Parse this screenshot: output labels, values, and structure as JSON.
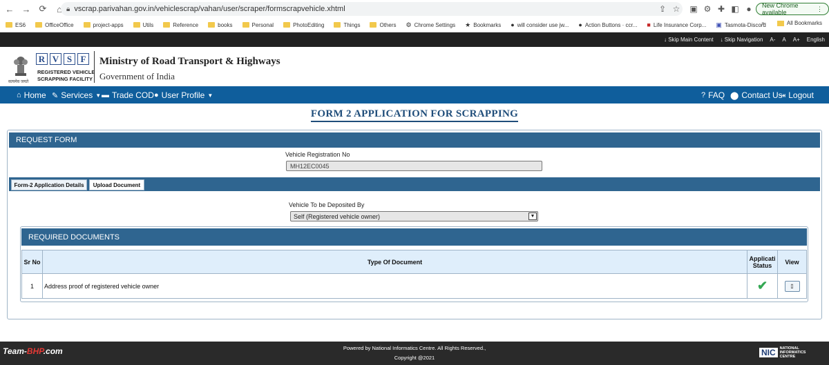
{
  "browser": {
    "url": "vscrap.parivahan.gov.in/vehiclescrap/vahan/user/scraper/formscrapvehicle.xhtml",
    "new_chrome": "New Chrome available",
    "bookmarks": [
      "ES6",
      "OfficeOffice",
      "project-apps",
      "Utils",
      "Reference",
      "books",
      "Personal",
      "PhotoEditing",
      "Things",
      "Others",
      "Chrome Settings",
      "Bookmarks",
      "will consider use jw...",
      "Action Buttons · ccr...",
      "Life Insurance Corp...",
      "Tasmota-Discord"
    ],
    "more_chevron": "»",
    "all_bookmarks": "All Bookmarks"
  },
  "accessibility": {
    "skip_main": "↓ Skip Main Content",
    "skip_nav": "↓ Skip Navigation",
    "font_minus": "A-",
    "font_normal": "A",
    "font_plus": "A+",
    "language": "English"
  },
  "header": {
    "rvsf_letters": [
      "R",
      "V",
      "S",
      "F"
    ],
    "rvsf_line1": "REGISTERED VEHICLE",
    "rvsf_line2": "SCRAPPING FACILITY",
    "emblem_text": "सत्यमेव जयते",
    "ministry": "Ministry of Road Transport & Highways",
    "government": "Government of India"
  },
  "nav": {
    "home": "Home",
    "services": "Services",
    "trade_cod": "Trade COD",
    "user_profile": "User Profile",
    "faq": "FAQ",
    "contact": "Contact Us",
    "logout": "Logout"
  },
  "form": {
    "title": "FORM 2 APPLICATION FOR SCRAPPING",
    "request_header": "REQUEST FORM",
    "vehicle_reg_label": "Vehicle Registration No",
    "vehicle_reg_value": "MH12EC0045",
    "tabs": [
      "Form-2 Application Details",
      "Upload Document"
    ],
    "deposited_label": "Vehicle To be Deposited By",
    "deposited_value": "Self (Registered vehicle owner)",
    "required_docs_header": "REQUIRED DOCUMENTS",
    "table": {
      "headers": [
        "Sr No",
        "Type Of Document",
        "Applicati Status",
        "View"
      ],
      "rows": [
        {
          "sr": "1",
          "type": "Address proof of registered vehicle owner"
        }
      ]
    }
  },
  "footer": {
    "powered": "Powered by National Informatics Centre. All Rights Reserved.,",
    "copyright": "Copyright @2021",
    "watermark_part1": "Team-",
    "watermark_part2": "BHP",
    "watermark_part3": ".com",
    "nic_logo": "NIC",
    "nic_line1": "NATIONAL",
    "nic_line2": "INFORMATICS",
    "nic_line3": "CENTRE"
  }
}
